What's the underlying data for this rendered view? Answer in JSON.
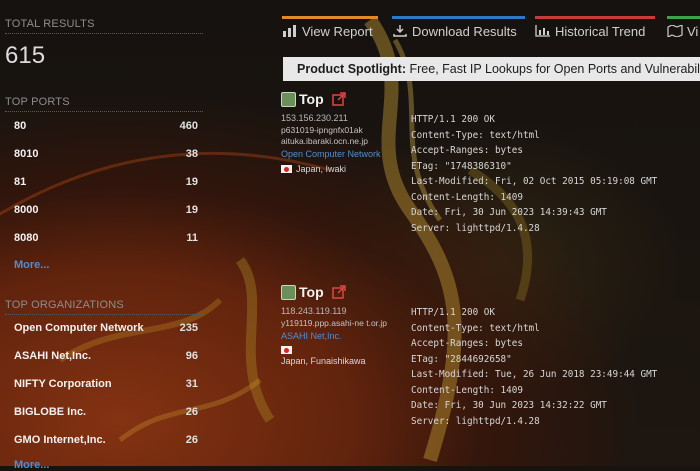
{
  "summary": {
    "total_label": "TOTAL RESULTS",
    "total_value": "615"
  },
  "top_ports": {
    "title": "TOP PORTS",
    "items": [
      {
        "label": "80",
        "count": "460"
      },
      {
        "label": "8010",
        "count": "38"
      },
      {
        "label": "81",
        "count": "19"
      },
      {
        "label": "8000",
        "count": "19"
      },
      {
        "label": "8080",
        "count": "11"
      }
    ],
    "more": "More..."
  },
  "top_orgs": {
    "title": "TOP ORGANIZATIONS",
    "items": [
      {
        "label": "Open Computer Network",
        "count": "235"
      },
      {
        "label": "ASAHI Net,Inc.",
        "count": "96"
      },
      {
        "label": "NIFTY Corporation",
        "count": "31"
      },
      {
        "label": "BIGLOBE Inc.",
        "count": "26"
      },
      {
        "label": "GMO Internet,Inc.",
        "count": "26"
      }
    ],
    "more": "More..."
  },
  "tabs": [
    {
      "label": "View Report",
      "color": "#e0892a",
      "icon": "bar-chart-icon"
    },
    {
      "label": "Download Results",
      "color": "#2f78c4",
      "icon": "download-icon"
    },
    {
      "label": "Historical Trend",
      "color": "#c93a3a",
      "icon": "line-chart-icon"
    },
    {
      "label": "Vi",
      "color": "#3aa24a",
      "icon": "map-icon"
    }
  ],
  "spotlight": {
    "label": "Product Spotlight:",
    "text": "Free, Fast IP Lookups for Open Ports and Vulnerabilities"
  },
  "results": [
    {
      "title": "Top",
      "ip": "153.156.230.211",
      "hostname": "p631019-ipngnfx01ak aituka.ibaraki.ocn.ne.jp",
      "org": "Open Computer Network",
      "location": "Japan, Iwaki",
      "banner": "HTTP/1.1 200 OK\nContent-Type: text/html\nAccept-Ranges: bytes\nETag: \"1748386310\"\nLast-Modified: Fri, 02 Oct 2015 05:19:08 GMT\nContent-Length: 1409\nDate: Fri, 30 Jun 2023 14:39:43 GMT\nServer: lighttpd/1.4.28"
    },
    {
      "title": "Top",
      "ip": "118.243.119.119",
      "hostname": "y119119.ppp.asahi-ne t.or.jp",
      "org": "ASAHI Net,Inc.",
      "location": "Japan, Funaishikawa",
      "banner": "HTTP/1.1 200 OK\nContent-Type: text/html\nAccept-Ranges: bytes\nETag: \"2844692658\"\nLast-Modified: Tue, 26 Jun 2018 23:49:44 GMT\nContent-Length: 1409\nDate: Fri, 30 Jun 2023 14:32:22 GMT\nServer: lighttpd/1.4.28"
    }
  ]
}
